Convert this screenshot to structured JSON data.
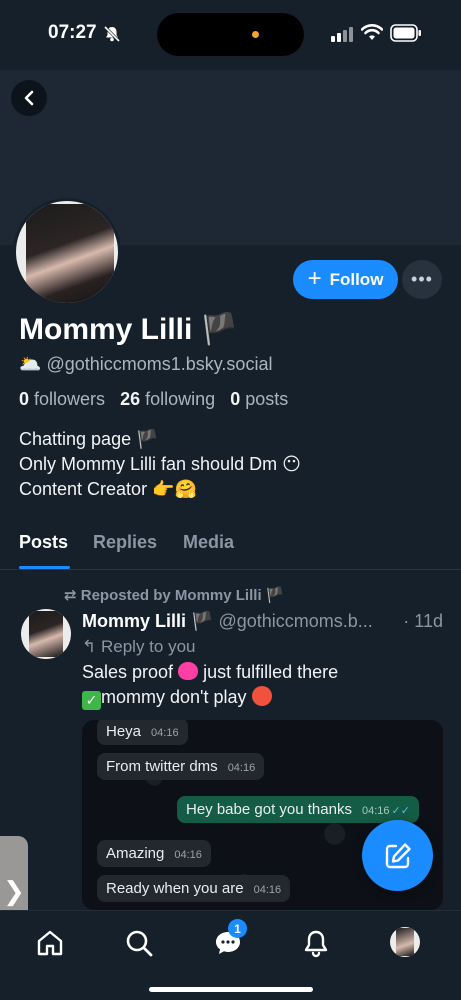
{
  "status_bar": {
    "time": "07:27",
    "icons": [
      "bell-slash-icon",
      "signal-icon",
      "wifi-icon",
      "battery-icon"
    ]
  },
  "profile": {
    "display_name": "Mommy Lilli 🏴",
    "handle_prefix": "🌥️",
    "handle": "@gothiccmoms1.bsky.social",
    "followers_count": "0",
    "followers_label": "followers",
    "following_count": "26",
    "following_label": "following",
    "posts_count": "0",
    "posts_label": "posts",
    "bio": [
      "Chatting page 🏴",
      "Only Mommy Lilli fan should Dm 😶",
      "Content Creator 👉🤗"
    ],
    "follow_label": "Follow",
    "more_label": "•••"
  },
  "tabs": [
    {
      "label": "Posts",
      "active": true
    },
    {
      "label": "Replies",
      "active": false
    },
    {
      "label": "Media",
      "active": false
    }
  ],
  "post": {
    "repost_label": "Reposted by Mommy Lilli 🏴",
    "author": "Mommy Lilli 🏴",
    "handle": "@gothiccmoms.b...",
    "time": "· 11d",
    "reply_to": "Reply to you",
    "text_line1_a": "Sales proof",
    "text_line1_b": "just fulfilled there",
    "text_line2_a": "mommy don't play",
    "chat": {
      "messages": [
        {
          "text": "Heya",
          "time": "04:16",
          "outgoing": false
        },
        {
          "text": "From twitter dms",
          "time": "04:16",
          "outgoing": false
        },
        {
          "text": "Hey babe got you thanks",
          "time": "04:16",
          "outgoing": true
        },
        {
          "text": "Amazing",
          "time": "04:16",
          "outgoing": false
        },
        {
          "text": "Ready when you are",
          "time": "04:16",
          "outgoing": false
        }
      ]
    }
  },
  "nav": {
    "items": [
      "home-icon",
      "search-icon",
      "chat-icon",
      "notifications-icon",
      "profile-avatar"
    ],
    "chat_badge": "1"
  },
  "colors": {
    "accent": "#1a8cff",
    "background": "#16202b"
  }
}
